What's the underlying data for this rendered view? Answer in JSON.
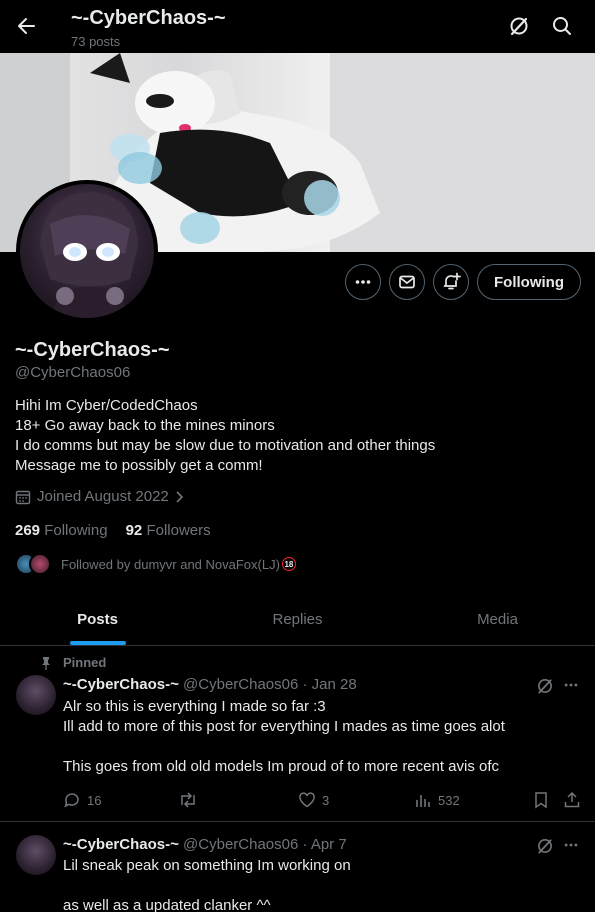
{
  "header": {
    "name": "~-CyberChaos-~",
    "post_count": "73 posts"
  },
  "profile": {
    "display_name": "~-CyberChaos-~",
    "handle": "@CyberChaos06",
    "bio": [
      "Hihi Im Cyber/CodedChaos",
      "18+ Go away back to the mines minors",
      "I do comms but may be slow due to motivation and other things",
      "Message me to possibly get a comm!"
    ],
    "joined": "Joined August 2022",
    "following_count": "269",
    "following_label": "Following",
    "followers_count": "92",
    "followers_label": "Followers",
    "followed_by": "Followed by dumyvr and NovaFox(LJ)",
    "followed_by_badge": "18",
    "follow_button": "Following"
  },
  "tabs": [
    {
      "label": "Posts",
      "active": true
    },
    {
      "label": "Replies",
      "active": false
    },
    {
      "label": "Media",
      "active": false
    }
  ],
  "posts": [
    {
      "pinned_label": "Pinned",
      "name": "~-CyberChaos-~",
      "meta": "@CyberChaos06 · Jan 28",
      "lines": [
        "Alr so this is everything I made so far :3",
        "Ill add to more of this post for everything I mades as time goes alot",
        "",
        "This goes from old old models Im proud of to more recent avis ofc"
      ],
      "replies": "16",
      "reposts": "",
      "likes": "3",
      "views": "532"
    },
    {
      "name": "~-CyberChaos-~",
      "meta": "@CyberChaos06 · Apr 7",
      "lines": [
        "Lil sneak peak on something Im working on",
        "",
        "as well as a updated clanker ^^"
      ]
    }
  ],
  "colors": {
    "accent": "#1d9bf0",
    "muted": "#71767b",
    "text": "#e7e9ea",
    "background": "#000000",
    "badge": "#f4212e"
  }
}
